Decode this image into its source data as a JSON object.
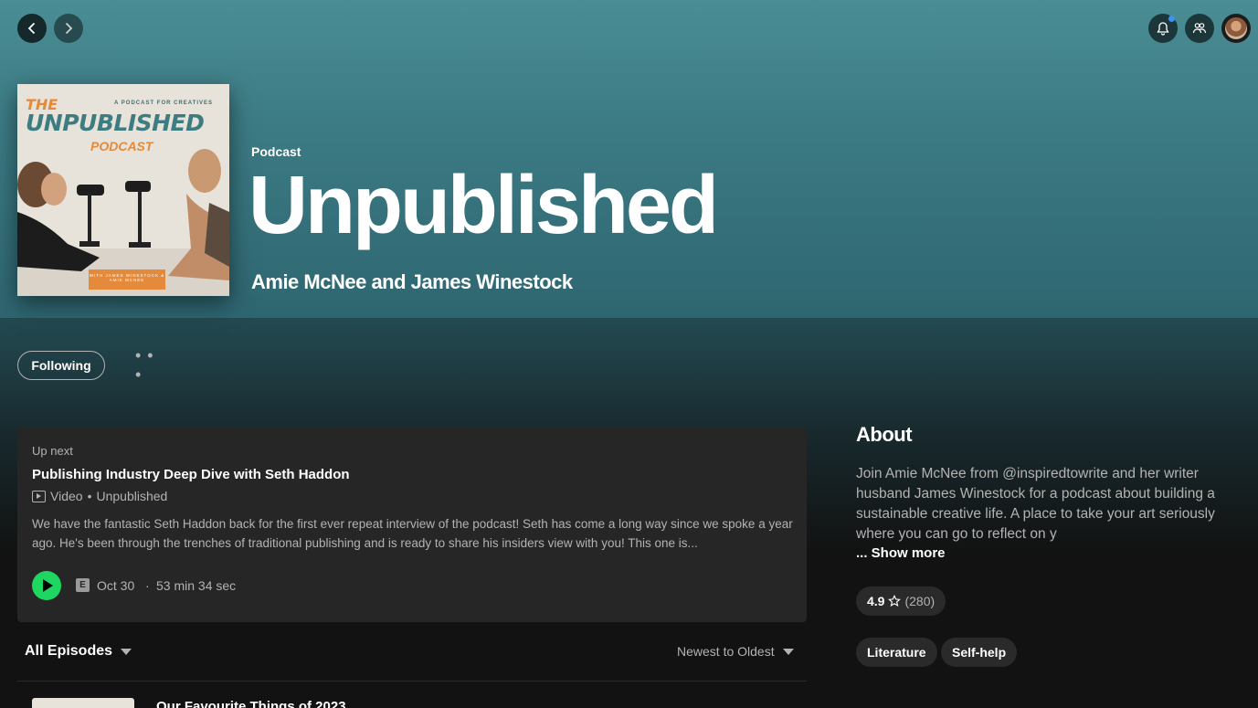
{
  "nav": {
    "back_icon": "chevron-left-icon",
    "forward_icon": "chevron-right-icon"
  },
  "topbar": {
    "icons": [
      "bell-icon",
      "friends-icon",
      "avatar"
    ]
  },
  "podcast": {
    "kind": "Podcast",
    "title": "Unpublished",
    "authors": "Amie McNee and James Winestock",
    "cover": {
      "the": "THE",
      "tagline": "A PODCAST FOR CREATIVES",
      "title": "UNPUBLISHED",
      "sub": "PODCAST",
      "band": "WITH JAMES WINESTOCK & AMIE MCNEE"
    }
  },
  "actions": {
    "follow_label": "Following",
    "more_label": "• • •"
  },
  "upnext": {
    "label": "Up next",
    "title": "Publishing Industry Deep Dive with Seth Haddon",
    "meta_type": "Video",
    "meta_sep": "•",
    "meta_show": "Unpublished",
    "description": "We have the fantastic Seth Haddon back for the first ever repeat interview of the podcast! Seth has come a long way since we spoke a year ago. He's been through the trenches of traditional publishing and is ready to share his insiders view with you! This one is...",
    "explicit": "E",
    "date": "Oct 30",
    "dot": "·",
    "duration": "53 min 34 sec"
  },
  "episodes": {
    "filter_label": "All Episodes",
    "sort_label": "Newest to Oldest",
    "next_title": "Our Favourite Things of 2023"
  },
  "about": {
    "heading": "About",
    "text": "Join Amie McNee from @inspiredtowrite and her writer husband James Winestock for a podcast about building a sustainable creative life. A place to take your art seriously where you can go to reflect on y",
    "show_more": "... Show more",
    "rating": "4.9",
    "rating_count": "(280)",
    "tags": [
      "Literature",
      "Self-help"
    ]
  },
  "colors": {
    "accent": "#1ed760",
    "hero": "#3c7b84",
    "background": "#121212"
  }
}
